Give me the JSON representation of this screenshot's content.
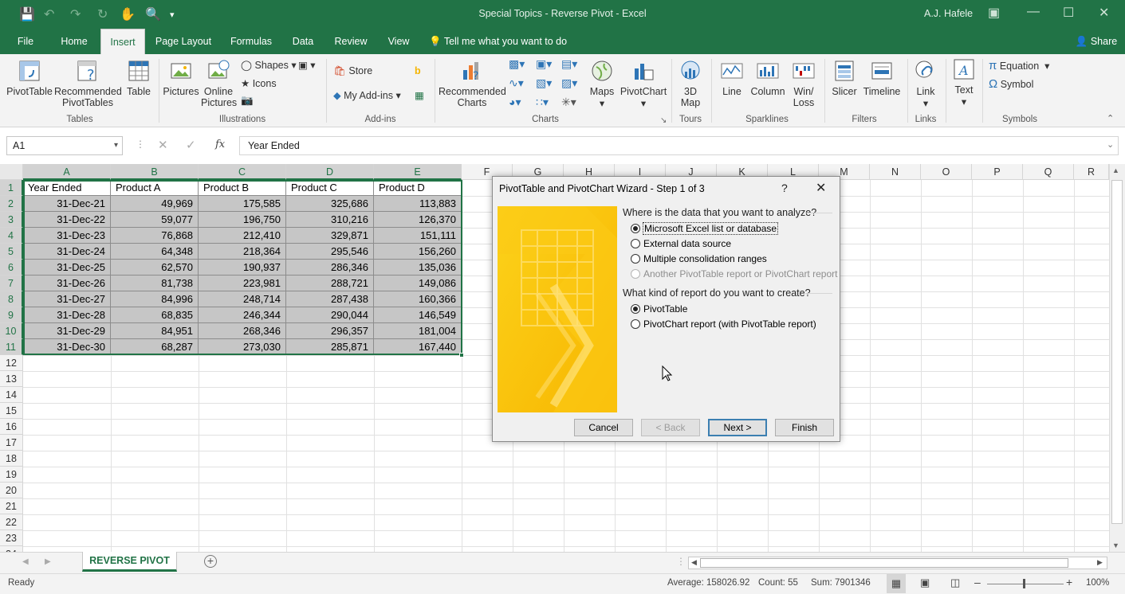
{
  "window": {
    "title": "Special Topics - Reverse Pivot  -  Excel",
    "user": "A.J. Hafele"
  },
  "menu": {
    "tabs": [
      "File",
      "Home",
      "Insert",
      "Page Layout",
      "Formulas",
      "Data",
      "Review",
      "View"
    ],
    "tell_me": "Tell me what you want to do",
    "share": "Share"
  },
  "ribbon": {
    "pivottable": "PivotTable",
    "recommended_pivot_1": "Recommended",
    "recommended_pivot_2": "PivotTables",
    "table": "Table",
    "pictures": "Pictures",
    "online_1": "Online",
    "online_2": "Pictures",
    "shapes": "Shapes",
    "icons": "Icons",
    "store": "Store",
    "my_addins": "My Add-ins",
    "recommended_charts_1": "Recommended",
    "recommended_charts_2": "Charts",
    "maps": "Maps",
    "pivotchart": "PivotChart",
    "map3d_1": "3D",
    "map3d_2": "Map",
    "line": "Line",
    "column": "Column",
    "winloss_1": "Win/",
    "winloss_2": "Loss",
    "slicer": "Slicer",
    "timeline": "Timeline",
    "link": "Link",
    "text": "Text",
    "equation": "Equation",
    "symbol": "Symbol",
    "groups": {
      "tables": "Tables",
      "illustrations": "Illustrations",
      "addins": "Add-ins",
      "charts": "Charts",
      "tours": "Tours",
      "sparklines": "Sparklines",
      "filters": "Filters",
      "links": "Links",
      "symbols": "Symbols"
    }
  },
  "formula_bar": {
    "name_box": "A1",
    "fx": "fx",
    "value": "Year Ended"
  },
  "sheet": {
    "columns": [
      "A",
      "B",
      "C",
      "D",
      "E",
      "F",
      "G",
      "H",
      "I",
      "J",
      "K",
      "L",
      "M",
      "N",
      "O",
      "P",
      "Q",
      "R"
    ],
    "rows": [
      "1",
      "2",
      "3",
      "4",
      "5",
      "6",
      "7",
      "8",
      "9",
      "10",
      "11",
      "12",
      "13",
      "14",
      "15",
      "16",
      "17",
      "18",
      "19",
      "20",
      "21",
      "22",
      "23",
      "24"
    ],
    "header": [
      "Year Ended",
      "Product A",
      "Product B",
      "Product C",
      "Product D"
    ],
    "data": [
      [
        "31-Dec-21",
        "49,969",
        "175,585",
        "325,686",
        "113,883"
      ],
      [
        "31-Dec-22",
        "59,077",
        "196,750",
        "310,216",
        "126,370"
      ],
      [
        "31-Dec-23",
        "76,868",
        "212,410",
        "329,871",
        "151,111"
      ],
      [
        "31-Dec-24",
        "64,348",
        "218,364",
        "295,546",
        "156,260"
      ],
      [
        "31-Dec-25",
        "62,570",
        "190,937",
        "286,346",
        "135,036"
      ],
      [
        "31-Dec-26",
        "81,738",
        "223,981",
        "288,721",
        "149,086"
      ],
      [
        "31-Dec-27",
        "84,996",
        "248,714",
        "287,438",
        "160,366"
      ],
      [
        "31-Dec-28",
        "68,835",
        "246,344",
        "290,044",
        "146,549"
      ],
      [
        "31-Dec-29",
        "84,951",
        "268,346",
        "296,357",
        "181,004"
      ],
      [
        "31-Dec-30",
        "68,287",
        "273,030",
        "285,871",
        "167,440"
      ]
    ],
    "tab": "REVERSE PIVOT"
  },
  "dialog": {
    "title": "PivotTable and PivotChart Wizard - Step 1 of 3",
    "help": "?",
    "q1": "Where is the data that you want to analyze?",
    "opt1": "Microsoft Excel list or database",
    "opt2": "External data source",
    "opt3": "Multiple consolidation ranges",
    "opt4": "Another PivotTable report or PivotChart report",
    "q2": "What kind of report do you want to create?",
    "opt5": "PivotTable",
    "opt6": "PivotChart report (with PivotTable report)",
    "cancel": "Cancel",
    "back": "< Back",
    "next": "Next >",
    "finish": "Finish"
  },
  "status": {
    "ready": "Ready",
    "average": "Average: 158026.92",
    "count": "Count: 55",
    "sum": "Sum: 7901346",
    "zoom": "100%"
  },
  "colors": {
    "excel_green": "#217346",
    "selection_fill": "#c6c6c6"
  }
}
